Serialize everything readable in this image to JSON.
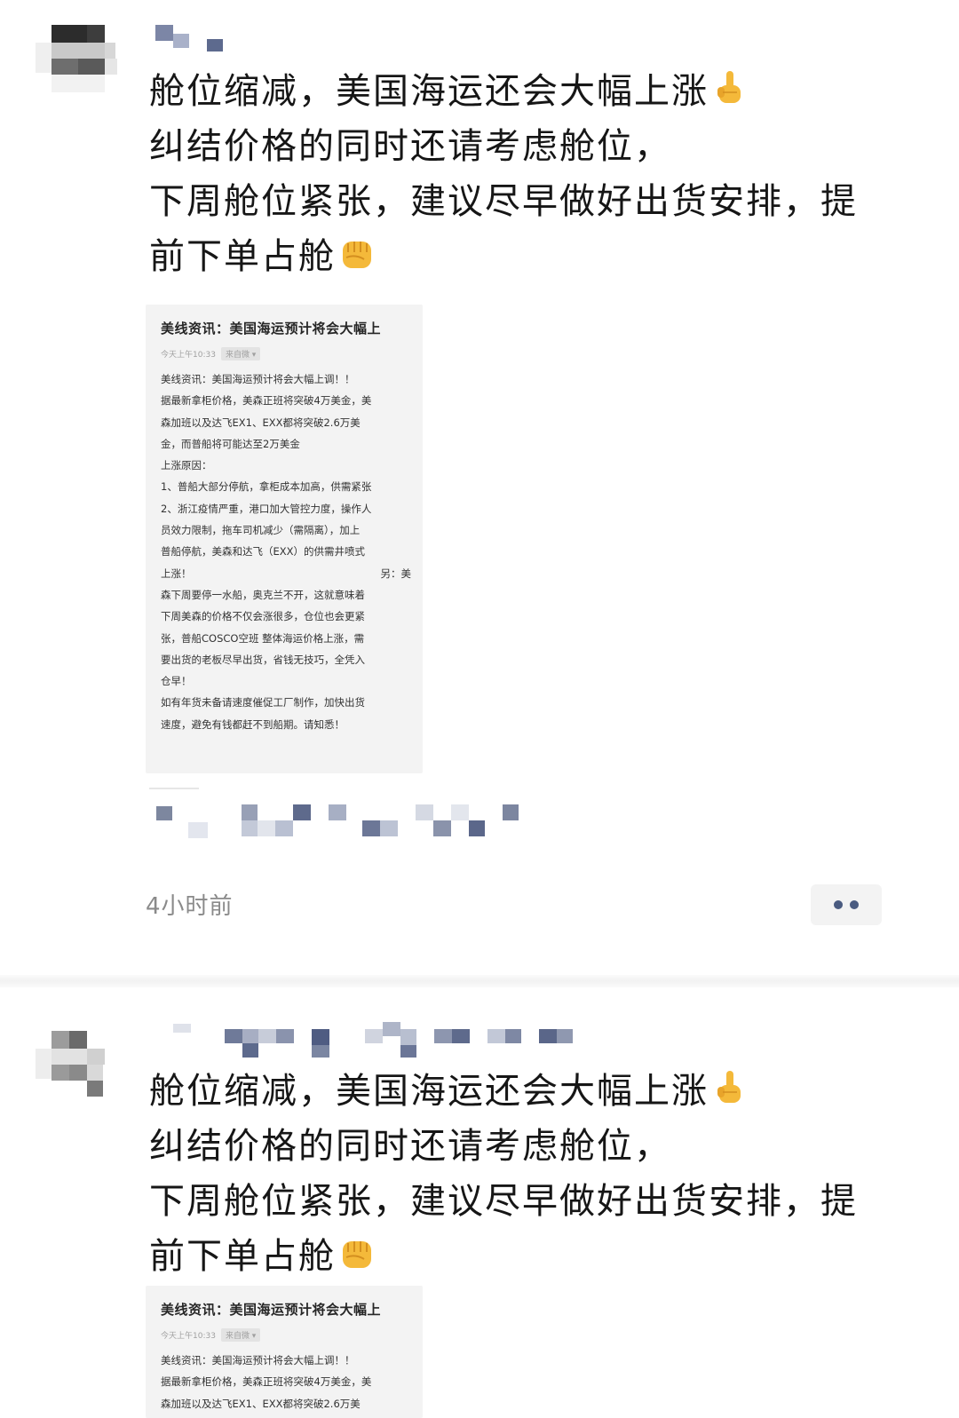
{
  "post_text_lines": [
    "舱位缩减，美国海运还会大幅上涨",
    "纠结价格的同时还请考虑舱位，",
    "下周舱位紧张，建议尽早做好出货安排，提",
    "前下单占舱"
  ],
  "emojis": {
    "first_line": "pointing-up-hand-icon",
    "last_line": "raised-fist-icon"
  },
  "article": {
    "title": "美线资讯：美国海运预计将会大幅上",
    "meta_time": "今天上午10:33",
    "meta_source": "来自微 ▾",
    "body_lines": [
      "美线资讯：美国海运预计将会大幅上调！！",
      "据最新拿柜价格，美森正班将突破4万美金，美",
      "森加班以及达飞EX1、EXX都将突破2.6万美",
      "金，而普船将可能达至2万美金",
      "上涨原因：",
      "1、普船大部分停航，拿柜成本加高，供需紧张",
      "2、浙江疫情严重，港口加大管控力度，操作人",
      "员效力限制，拖车司机减少（需隔离），加上",
      "普船停航，美森和达飞（EXX）的供需井喷式",
      "上涨！",
      "森下周要停一水船，奥克兰不开，这就意味着",
      "下周美森的价格不仅会涨很多，仓位也会更紧",
      "张，普船COSCO空班 整体海运价格上涨，需",
      "要出货的老板尽早出货，省钱无技巧，全凭入",
      "仓早！",
      "如有年货未备请速度催促工厂制作，加快出货",
      "速度，避免有钱都赶不到船期。请知悉！"
    ],
    "body_line_10_right": "另：美"
  },
  "timestamp": "4小时前",
  "colors": {
    "text": "#161616",
    "timestamp": "#8a8a8a",
    "card_bg": "#f3f3f3",
    "more_dots": "#4a5b80"
  }
}
